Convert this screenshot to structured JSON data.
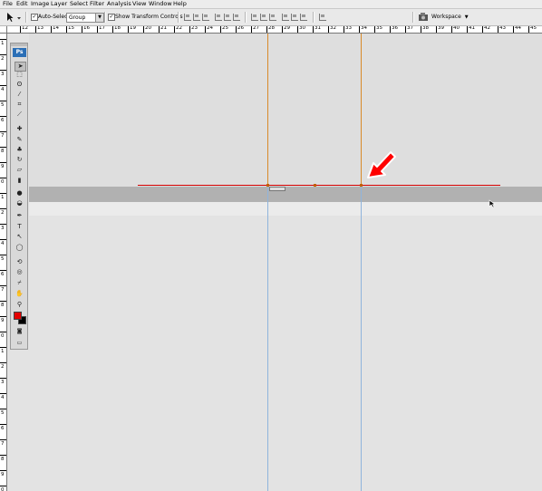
{
  "menubar": {
    "items": [
      {
        "label": "File"
      },
      {
        "label": "Edit"
      },
      {
        "label": "Image"
      },
      {
        "label": "Layer"
      },
      {
        "label": "Select"
      },
      {
        "label": "Filter"
      },
      {
        "label": "Analysis"
      },
      {
        "label": "View"
      },
      {
        "label": "Window"
      },
      {
        "label": "Help"
      }
    ]
  },
  "options_bar": {
    "auto_select_label": "Auto-Select:",
    "auto_select_checked": true,
    "auto_select_value": "Group",
    "show_transform_label": "Show Transform Controls",
    "show_transform_checked": true,
    "workspace_label": "Workspace"
  },
  "ruler": {
    "h_labels": [
      "12",
      "13",
      "14",
      "15",
      "16",
      "17",
      "18",
      "19",
      "20",
      "21",
      "22",
      "23",
      "24",
      "25",
      "26",
      "27",
      "28",
      "29",
      "30",
      "31",
      "32",
      "33",
      "34",
      "35",
      "36",
      "37",
      "38",
      "39",
      "40",
      "41",
      "42",
      "43",
      "44",
      "45"
    ],
    "v_labels": [
      "1",
      "2",
      "3",
      "4",
      "5",
      "6",
      "7",
      "8",
      "9",
      "0",
      "1",
      "2",
      "3",
      "4",
      "5",
      "6",
      "7",
      "8",
      "9",
      "0",
      "1",
      "2",
      "3",
      "4",
      "5",
      "6",
      "7",
      "8",
      "9",
      "0"
    ]
  },
  "toolbox": {
    "logo_text": "Ps",
    "tools": [
      "move",
      "marquee",
      "lasso",
      "magic-wand",
      "crop",
      "slice",
      "healing",
      "brush",
      "stamp",
      "history-brush",
      "eraser",
      "gradient",
      "blur",
      "dodge",
      "pen",
      "type",
      "path-select",
      "shape",
      "3d-rotate",
      "3d-orbit",
      "eyedropper",
      "hand",
      "zoom"
    ],
    "foreground_color": "#e40000",
    "background_color": "#000000"
  },
  "colors": {
    "guide_orange": "#d98a2a",
    "guide_blue": "#8fb4dc",
    "path_red": "#d40000",
    "arrow_red": "#ff0000"
  }
}
